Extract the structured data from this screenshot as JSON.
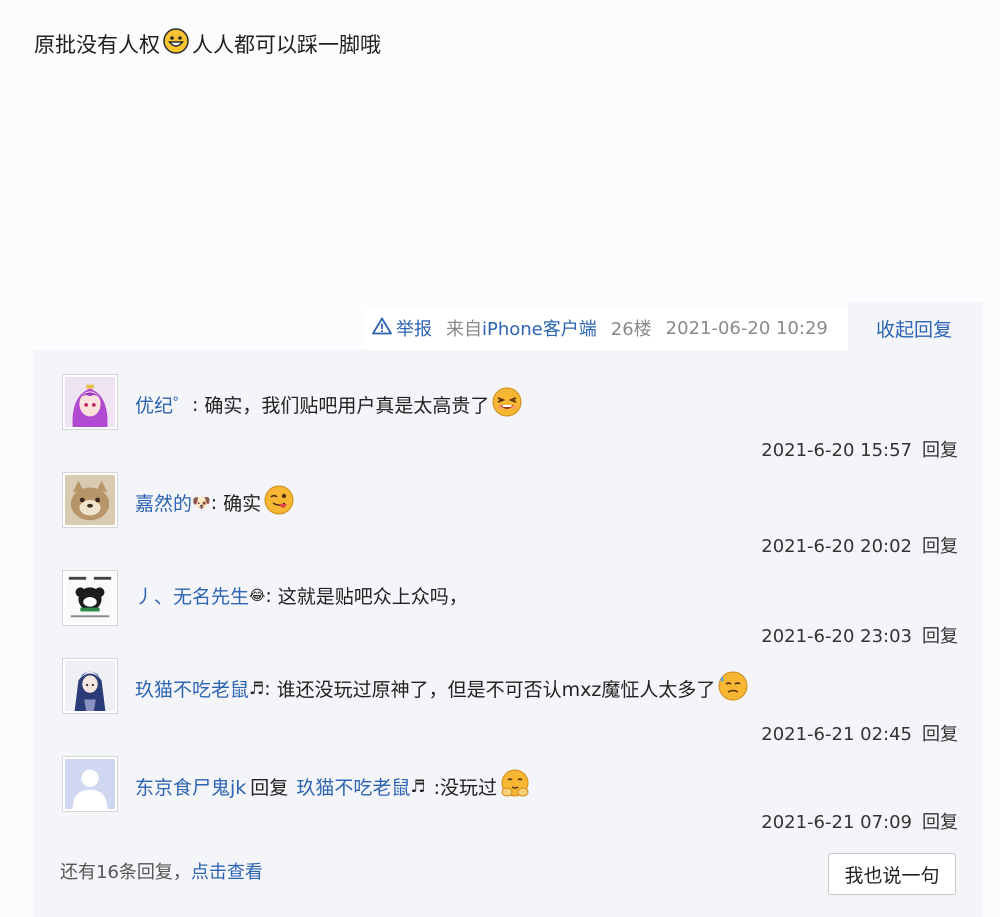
{
  "post": {
    "text_before": "原批没有人权",
    "emoji": "grin-emoji",
    "text_after": "人人都可以踩一脚哦"
  },
  "meta": {
    "report_label": "举报",
    "client_prefix": "来自",
    "client_name": "iPhone客户端",
    "floor": "26楼",
    "time": "2021-06-20 10:29",
    "collapse_label": "收起回复"
  },
  "replies": [
    {
      "user": "优纪゜",
      "user_suffix": "",
      "separator": ":",
      "text": "确实，我们贴吧用户真是太高贵了",
      "emoji": "laugh-squint-emoji",
      "time": "2021-6-20 15:57",
      "reply_label": "回复"
    },
    {
      "user": "嘉然的",
      "user_suffix": "🐶",
      "separator": ":",
      "text": "确实",
      "emoji": "tongue-out-emoji",
      "time": "2021-6-20 20:02",
      "reply_label": "回复"
    },
    {
      "user": "丿、无名先生",
      "user_suffix": "😂",
      "separator": ":",
      "text": "这就是贴吧众上众吗，",
      "emoji": "",
      "time": "2021-6-20 23:03",
      "reply_label": "回复"
    },
    {
      "user": "玖猫不吃老鼠",
      "user_suffix": "♬",
      "separator": ":",
      "text": "谁还没玩过原神了，但是不可否认mxz魔怔人太多了",
      "emoji": "sweat-emoji",
      "time": "2021-6-21 02:45",
      "reply_label": "回复"
    },
    {
      "user": "东京食尸鬼jk",
      "user_suffix": "",
      "separator": ":",
      "reply_word": "回复",
      "reply_target": "玖猫不吃老鼠",
      "reply_target_suffix": "♬",
      "text": ":没玩过",
      "emoji": "blush-hands-emoji",
      "time": "2021-6-21 07:09",
      "reply_label": "回复"
    }
  ],
  "footer": {
    "more_text": "还有16条回复，",
    "view_label": "点击查看",
    "say_button": "我也说一句"
  },
  "colors": {
    "link": "#2d64b3",
    "panel_bg": "#f4f5f8",
    "emoji_face": "#f7b733"
  }
}
